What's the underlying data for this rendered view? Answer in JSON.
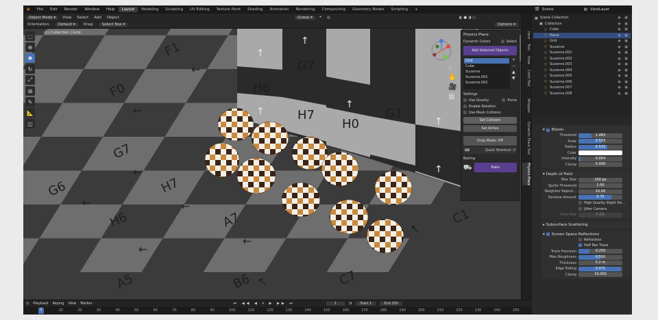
{
  "menubar": {
    "menus": [
      "File",
      "Edit",
      "Render",
      "Window",
      "Help"
    ],
    "workspaces": [
      "Layout",
      "Modeling",
      "Sculpting",
      "UV Editing",
      "Texture Paint",
      "Shading",
      "Animation",
      "Rendering",
      "Compositing",
      "Geometry Nodes",
      "Scripting"
    ],
    "scene_label": "Scene",
    "view_layer_label": "ViewLayer"
  },
  "header": {
    "mode": "Object Mode",
    "menus": [
      "View",
      "Select",
      "Add",
      "Object"
    ],
    "transform": "Global",
    "options": "Options"
  },
  "toolheader": {
    "orientation_label": "Orientation:",
    "orientation_value": "Default",
    "drag_label": "Drag:",
    "drag_value": "Select Box"
  },
  "viewport": {
    "overlay_text": "(1) Collection | Grid",
    "floor_labels": [
      "F1",
      "F0",
      "G7",
      "G6",
      "H7",
      "H6",
      "A7",
      "B6",
      "A5",
      "C7",
      "C1"
    ],
    "wall_labels": [
      "G7",
      "H6",
      "H7",
      "G1",
      "H0"
    ]
  },
  "npanel": {
    "title": "Physics Place",
    "dynamic_colors_label": "Dynamic Colors",
    "select_label": "Select",
    "add_button": "Add Selected Objects",
    "list_items": [
      "Grid",
      "Cube",
      "Suzanne",
      "Suzanne.001",
      "Suzanne.002"
    ],
    "settings_label": "Settings",
    "use_gravity": "Use Gravity",
    "force": "Force",
    "enable_rotation": "Enable Rotation",
    "use_mesh_collision": "Use Mesh Collision",
    "set_collision": "Set Collision",
    "set_active": "Set Active",
    "drop_mode": "Drop Mode: Off",
    "quick_shortcut": "Quick Shortcut: U",
    "baking_label": "Baking",
    "bake_button": "Bake"
  },
  "side_tabs": [
    "Item",
    "Tool",
    "View",
    "Cloth Tool",
    "Wrapper",
    "Dynamic Place Tool",
    "Physics Place"
  ],
  "outliner": {
    "rows": [
      {
        "label": "Scene Collection",
        "indent": 0,
        "selected": false
      },
      {
        "label": "Collection",
        "indent": 1,
        "selected": false
      },
      {
        "label": "Cube",
        "indent": 2,
        "selected": false
      },
      {
        "label": "Plane",
        "indent": 2,
        "selected": true
      },
      {
        "label": "Grid",
        "indent": 2,
        "selected": false
      },
      {
        "label": "Suzanne",
        "indent": 2,
        "selected": false
      },
      {
        "label": "Suzanne.001",
        "indent": 2,
        "selected": false
      },
      {
        "label": "Suzanne.002",
        "indent": 2,
        "selected": false
      },
      {
        "label": "Suzanne.003",
        "indent": 2,
        "selected": false
      },
      {
        "label": "Suzanne.004",
        "indent": 2,
        "selected": false
      },
      {
        "label": "Suzanne.005",
        "indent": 2,
        "selected": false
      },
      {
        "label": "Suzanne.006",
        "indent": 2,
        "selected": false
      },
      {
        "label": "Suzanne.007",
        "indent": 2,
        "selected": false
      },
      {
        "label": "Suzanne.008",
        "indent": 2,
        "selected": false
      }
    ]
  },
  "properties": {
    "bloom": {
      "title": "Bloom",
      "rows": [
        {
          "label": "Threshold",
          "value": "1.483",
          "fill": 0.3
        },
        {
          "label": "Knee",
          "value": "0.533",
          "fill": 0.53
        },
        {
          "label": "Radius",
          "value": "6.533",
          "fill": 0.65
        },
        {
          "label": "Color",
          "value": "",
          "fill": 0
        },
        {
          "label": "Intensity",
          "value": "0.054",
          "fill": 0.05
        },
        {
          "label": "Clamp",
          "value": "0.000",
          "fill": 0
        }
      ]
    },
    "dof": {
      "title": "Depth of Field",
      "rows": [
        {
          "label": "Max Size",
          "value": "100 px",
          "fill": 0
        },
        {
          "label": "Sprite Threshold",
          "value": "1.00",
          "fill": 0.0
        },
        {
          "label": "Neighbor Rejecti...",
          "value": "10.00",
          "fill": 0
        },
        {
          "label": "Denoise Amount",
          "value": "0.75",
          "fill": 0.75
        }
      ],
      "high_quality": "High Quality Slight De...",
      "jitter": "Jitter Camera",
      "over_blur_label": "Over-blur",
      "over_blur_value": "5.0%"
    },
    "sss_title": "Subsurface Scattering",
    "ssr": {
      "title": "Screen Space Reflections",
      "refraction": "Refraction",
      "half_res": "Half Res Trace",
      "rows": [
        {
          "label": "Trace Precision",
          "value": "0.250",
          "fill": 0.25
        },
        {
          "label": "Max Roughness",
          "value": "0.500",
          "fill": 0.5
        },
        {
          "label": "Thickness",
          "value": "0.2 m",
          "fill": 0
        },
        {
          "label": "Edge Fading",
          "value": "0.075",
          "fill": 0.975
        },
        {
          "label": "Clamp",
          "value": "10.000",
          "fill": 0
        }
      ]
    }
  },
  "timeline": {
    "menus": [
      "Playback",
      "Keying",
      "View",
      "Marker"
    ],
    "current_frame": "1",
    "start_label": "Start",
    "start_value": "1",
    "end_label": "End",
    "end_value": "250",
    "ticks": [
      "1",
      "10",
      "20",
      "30",
      "40",
      "50",
      "60",
      "70",
      "80",
      "90",
      "100",
      "110",
      "120",
      "130",
      "140",
      "150",
      "160",
      "170",
      "180",
      "190",
      "200",
      "210",
      "220",
      "230",
      "240",
      "250"
    ]
  },
  "colors": {
    "accent": "#4772b3",
    "purple_button": "#5a3f8f",
    "orange_suzanne": "#d97a2c"
  }
}
